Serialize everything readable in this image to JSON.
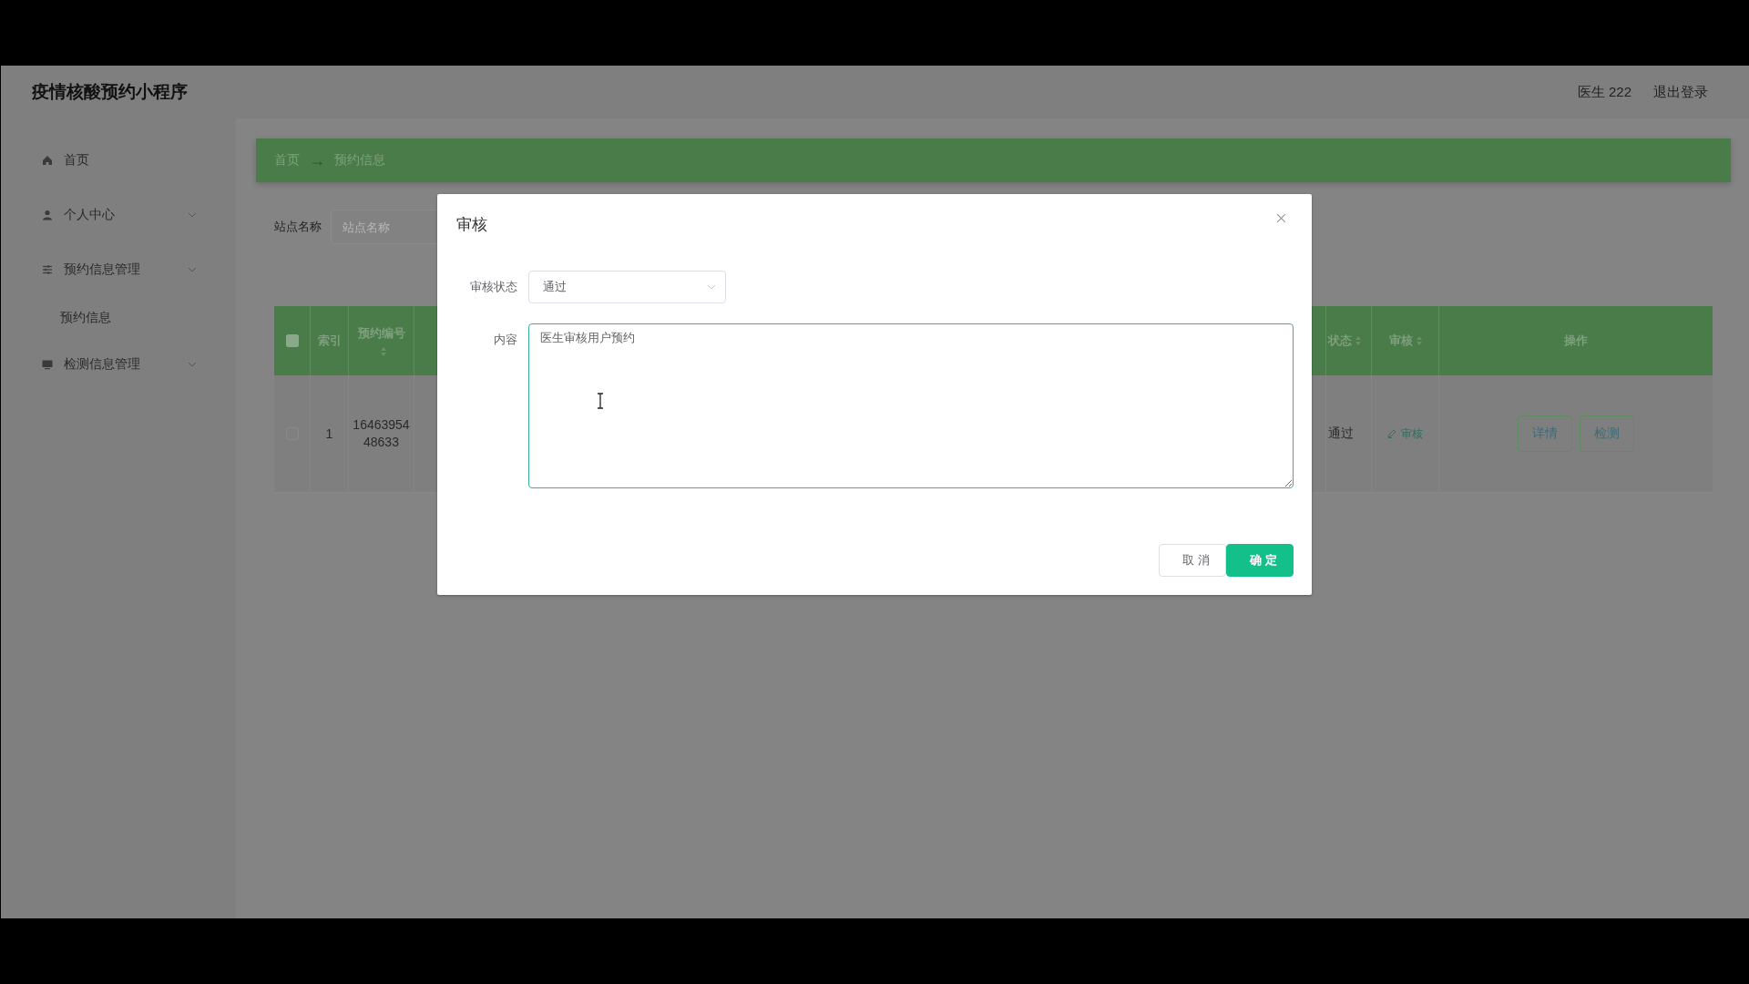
{
  "app": {
    "title": "疫情核酸预约小程序",
    "user": "医生 222",
    "logout": "退出登录"
  },
  "sidebar": {
    "items": [
      {
        "label": "首页",
        "submenu": false
      },
      {
        "label": "个人中心",
        "submenu": true
      },
      {
        "label": "预约信息管理",
        "submenu": true,
        "children": [
          {
            "label": "预约信息"
          }
        ]
      },
      {
        "label": "检测信息管理",
        "submenu": true
      }
    ]
  },
  "breadcrumb": {
    "items": [
      "首页",
      "预约信息"
    ],
    "separator": "→"
  },
  "search": {
    "label": "站点名称",
    "placeholder": "站点名称"
  },
  "table": {
    "columns": [
      {
        "kind": "checkbox",
        "checked": false
      },
      {
        "kind": "text",
        "label": "索引"
      },
      {
        "kind": "sortable",
        "label": "预约编号"
      },
      {
        "kind": "hidden"
      },
      {
        "kind": "sortable",
        "label": "状态"
      },
      {
        "kind": "sortable",
        "label": "审核"
      },
      {
        "kind": "text",
        "label": "操作"
      }
    ],
    "rows": [
      {
        "checked": false,
        "index": "1",
        "number": [
          "16463954",
          "48633"
        ],
        "status": "通过",
        "audit": "审核",
        "actions": [
          "详情",
          "检测"
        ]
      }
    ]
  },
  "dialog": {
    "title": "审核",
    "fields": [
      {
        "kind": "select",
        "label": "审核状态",
        "value": "通过"
      },
      {
        "kind": "textarea",
        "label": "内容",
        "value": "医生审核用户预约"
      }
    ],
    "buttons": [
      {
        "label": "取消",
        "primary": false
      },
      {
        "label": "确定",
        "primary": true
      }
    ]
  }
}
